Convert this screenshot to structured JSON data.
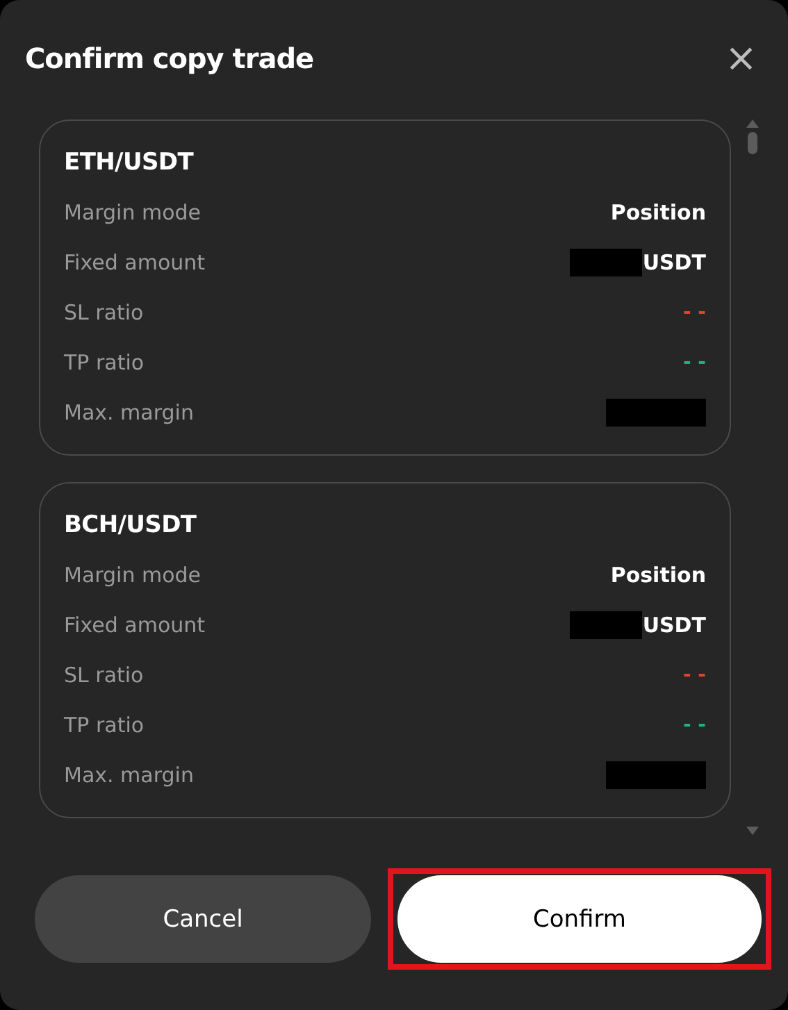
{
  "dialog": {
    "title": "Confirm copy trade",
    "close": "×"
  },
  "positions": [
    {
      "pair": "ETH/USDT",
      "rows": [
        {
          "kind": "text",
          "label": "Margin mode",
          "value": "Position"
        },
        {
          "kind": "amount",
          "label": "Fixed amount",
          "unit": "USDT"
        },
        {
          "kind": "dash",
          "label": "SL ratio",
          "value": "- -",
          "color": "#e5432f"
        },
        {
          "kind": "dash",
          "label": "TP ratio",
          "value": "- -",
          "color": "#1fb57f"
        },
        {
          "kind": "redacted",
          "label": "Max. margin"
        }
      ]
    },
    {
      "pair": "BCH/USDT",
      "rows": [
        {
          "kind": "text",
          "label": "Margin mode",
          "value": "Position"
        },
        {
          "kind": "amount",
          "label": "Fixed amount",
          "unit": "USDT"
        },
        {
          "kind": "dash",
          "label": "SL ratio",
          "value": "- -",
          "color": "#e5432f"
        },
        {
          "kind": "dash",
          "label": "TP ratio",
          "value": "- -",
          "color": "#1fb57f"
        },
        {
          "kind": "redacted",
          "label": "Max. margin"
        }
      ]
    }
  ],
  "buttons": [
    {
      "kind": "secondary",
      "label": "Cancel",
      "highlighted": false
    },
    {
      "kind": "primary",
      "label": "Confirm",
      "highlighted": true
    }
  ]
}
